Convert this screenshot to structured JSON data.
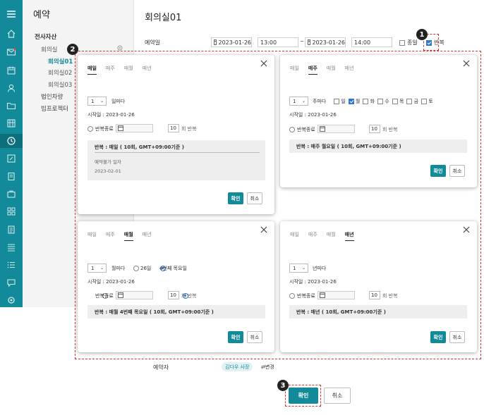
{
  "sidebar": {
    "title": "예약",
    "group": "전사자산",
    "items": [
      {
        "label": "회의실"
      },
      {
        "label": "회의실01"
      },
      {
        "label": "회의실02"
      },
      {
        "label": "회의실03"
      },
      {
        "label": "법인차량"
      },
      {
        "label": "빔프로젝터"
      }
    ]
  },
  "main": {
    "title": "회의실01",
    "date_label": "예약일",
    "start_date": "2023-01-26",
    "start_time": "13:00",
    "tilde": "~",
    "end_date": "2023-01-26",
    "end_time": "14:00",
    "allday_label": "종일",
    "repeat_label": "반복",
    "reserver_label": "예약자",
    "reserver_name": "김다우 사장",
    "change_label": "⇄변경",
    "confirm_label": "확인",
    "cancel_label": "취소"
  },
  "tabs": [
    "매일",
    "매주",
    "매월",
    "매년"
  ],
  "common": {
    "start_prefix": "시작일 : 2023-01-26",
    "repeat_end": "반복종료",
    "count": "10",
    "count_suffix": "회 반복",
    "ok": "확인",
    "cancel": "취소"
  },
  "dialogs": {
    "daily": {
      "interval": "1",
      "interval_unit": "일마다",
      "summary": "반복 : 매일 ( 10회, GMT+09:00기준 )",
      "unavailable_label": "예약불가 일자",
      "unavailable_date": "2023-02-01"
    },
    "weekly": {
      "interval": "1",
      "interval_unit": "주마다",
      "days": [
        "일",
        "월",
        "화",
        "수",
        "목",
        "금",
        "토"
      ],
      "checked_day": "월",
      "summary": "반복 : 매주 월요일 ( 10회, GMT+09:00기준 )"
    },
    "monthly": {
      "interval": "1",
      "interval_unit": "월마다",
      "option_day": "26일",
      "option_week": "4번째 목요일",
      "summary": "반복 : 매월 4번째 목요일 ( 10회, GMT+09:00기준 )"
    },
    "yearly": {
      "interval": "1",
      "interval_unit": "년마다",
      "summary": "반복 : 매년 ( 10회, GMT+09:00기준 )"
    }
  },
  "callouts": [
    "1",
    "2",
    "3"
  ]
}
